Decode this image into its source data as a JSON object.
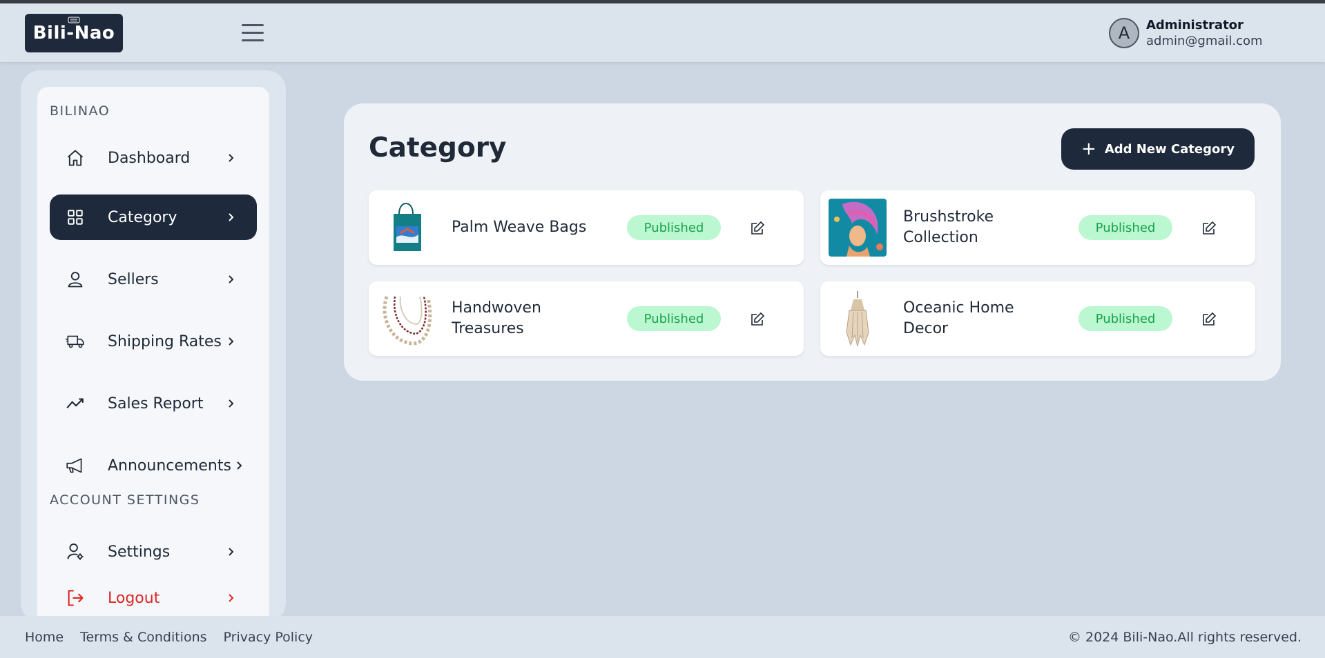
{
  "header": {
    "logo_text": "Bili-Nao",
    "user": {
      "avatar_letter": "A",
      "name": "Administrator",
      "email": "admin@gmail.com"
    }
  },
  "sidebar": {
    "section_main": "BILINAO",
    "items": [
      {
        "label": "Dashboard",
        "icon": "home-icon"
      },
      {
        "label": "Category",
        "icon": "grid-icon",
        "active": true
      },
      {
        "label": "Sellers",
        "icon": "user-icon"
      },
      {
        "label": "Shipping Rates",
        "icon": "truck-icon"
      },
      {
        "label": "Sales Report",
        "icon": "trend-icon"
      },
      {
        "label": "Announcements",
        "icon": "megaphone-icon"
      }
    ],
    "section_account": "ACCOUNT SETTINGS",
    "account_items": [
      {
        "label": "Settings",
        "icon": "user-settings-icon"
      },
      {
        "label": "Logout",
        "icon": "logout-icon"
      }
    ]
  },
  "main": {
    "title": "Category",
    "add_button_label": "Add New Category",
    "categories": [
      {
        "name": "Palm Weave Bags",
        "status": "Published"
      },
      {
        "name": "Brushstroke Collection",
        "status": "Published"
      },
      {
        "name": "Handwoven Treasures",
        "status": "Published"
      },
      {
        "name": "Oceanic Home Decor",
        "status": "Published"
      }
    ]
  },
  "footer": {
    "links": [
      "Home",
      "Terms & Conditions",
      "Privacy Policy"
    ],
    "copyright": "© 2024 Bili-Nao.All rights reserved."
  },
  "colors": {
    "brand_dark": "#1e2a3b",
    "published_bg": "#bbf7d0",
    "published_text": "#16a34a",
    "logout": "#dc2626"
  }
}
